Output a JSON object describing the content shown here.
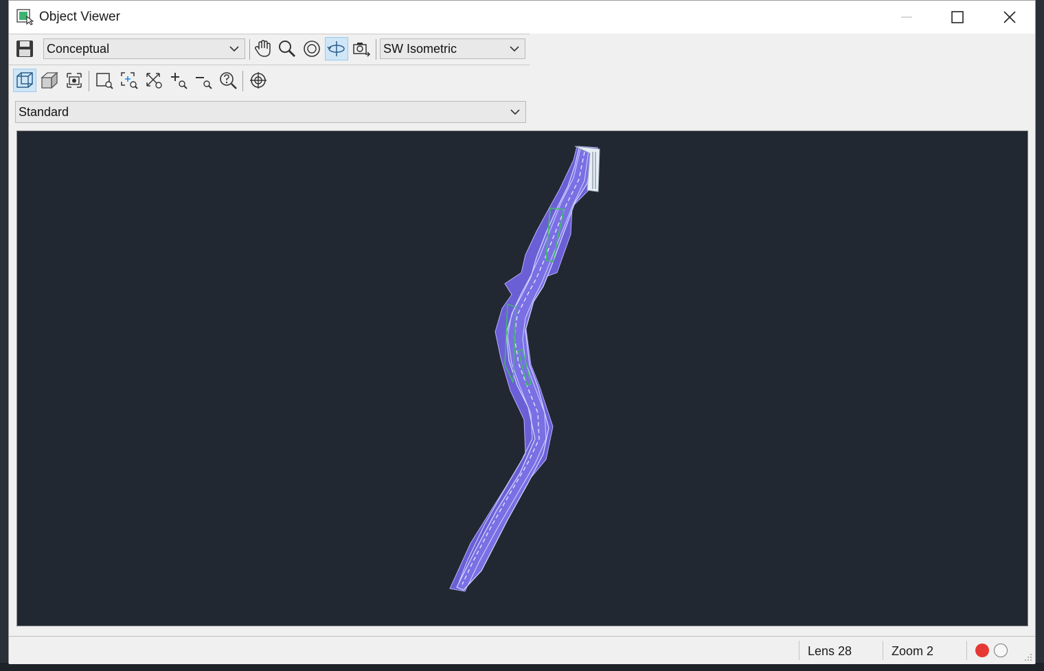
{
  "window": {
    "title": "Object Viewer"
  },
  "toolbar": {
    "visual_style": "Conceptual",
    "view_preset": "SW Isometric",
    "row1_icons": [
      "save-icon",
      "pan-hand-icon",
      "zoom-icon",
      "orbit-icon",
      "continuous-orbit-icon",
      "snapshot-icon"
    ],
    "row2_icons": [
      "parallel-projection-icon",
      "perspective-projection-icon",
      "camera-icon",
      "zoom-window-icon",
      "zoom-center-icon",
      "zoom-extents-icon",
      "zoom-in-icon",
      "zoom-out-icon",
      "zoom-help-icon",
      "ucs-target-icon"
    ]
  },
  "view_style_dropdown": {
    "value": "Standard"
  },
  "viewport": {
    "background": "#222831",
    "model_fill": "#6b5fd6",
    "model_edge": "#c8d4ff",
    "model_accent": "#3cc060"
  },
  "status": {
    "lens": "Lens 28",
    "zoom": "Zoom 2",
    "record_color": "#e53935"
  }
}
